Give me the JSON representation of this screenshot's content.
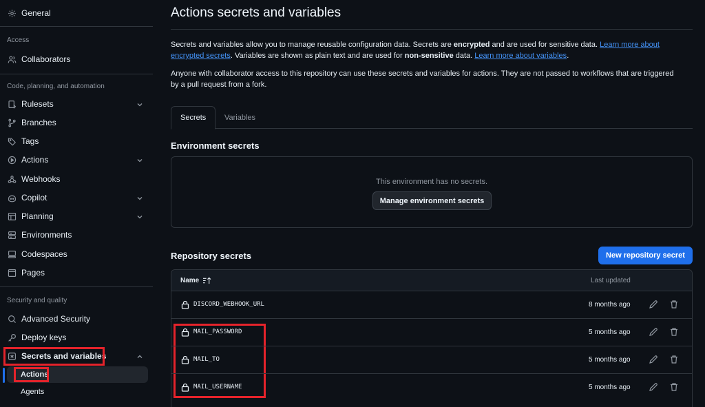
{
  "sidebar": {
    "items": [
      {
        "label": "General",
        "icon": "gear-icon"
      },
      {
        "label": "Collaborators",
        "icon": "people-icon"
      },
      {
        "label": "Rulesets",
        "icon": "repo-push-icon"
      },
      {
        "label": "Branches",
        "icon": "git-branch-icon"
      },
      {
        "label": "Tags",
        "icon": "tag-icon"
      },
      {
        "label": "Actions",
        "icon": "play-icon"
      },
      {
        "label": "Webhooks",
        "icon": "webhook-icon"
      },
      {
        "label": "Copilot",
        "icon": "copilot-icon"
      },
      {
        "label": "Planning",
        "icon": "table-icon"
      },
      {
        "label": "Environments",
        "icon": "server-icon"
      },
      {
        "label": "Codespaces",
        "icon": "codespaces-icon"
      },
      {
        "label": "Pages",
        "icon": "browser-icon"
      },
      {
        "label": "Advanced Security",
        "icon": "shield-search-icon"
      },
      {
        "label": "Deploy keys",
        "icon": "key-icon"
      },
      {
        "label": "Secrets and variables",
        "icon": "asterisk-icon"
      }
    ],
    "sections": {
      "access": "Access",
      "code": "Code, planning, and automation",
      "security": "Security and quality"
    },
    "sub_items": [
      {
        "label": "Actions"
      },
      {
        "label": "Agents"
      }
    ]
  },
  "main": {
    "title": "Actions secrets and variables",
    "desc1_a": "Secrets and variables allow you to manage reusable configuration data. Secrets are ",
    "desc1_b": "encrypted",
    "desc1_c": " and are used for sensitive data. ",
    "desc1_link1": "Learn more about encrypted secrets",
    "desc1_d": ". Variables are shown as plain text and are used for ",
    "desc1_e": "non-sensitive",
    "desc1_f": " data. ",
    "desc1_link2": "Learn more about variables",
    "desc1_g": ".",
    "desc2": "Anyone with collaborator access to this repository can use these secrets and variables for actions. They are not passed to workflows that are triggered by a pull request from a fork.",
    "tabs": [
      {
        "label": "Secrets"
      },
      {
        "label": "Variables"
      }
    ],
    "env_heading": "Environment secrets",
    "env_empty": "This environment has no secrets.",
    "env_button": "Manage environment secrets",
    "repo_heading": "Repository secrets",
    "new_button": "New repository secret",
    "table": {
      "col_name": "Name",
      "col_updated": "Last updated",
      "rows": [
        {
          "name": "DISCORD_WEBHOOK_URL",
          "updated": "8 months ago"
        },
        {
          "name": "MAIL_PASSWORD",
          "updated": "5 months ago"
        },
        {
          "name": "MAIL_TO",
          "updated": "5 months ago"
        },
        {
          "name": "MAIL_USERNAME",
          "updated": "5 months ago"
        }
      ]
    }
  },
  "colors": {
    "background": "#0d1117",
    "accent": "#1f6feb",
    "link": "#4493f8",
    "highlight": "#e5232b"
  }
}
